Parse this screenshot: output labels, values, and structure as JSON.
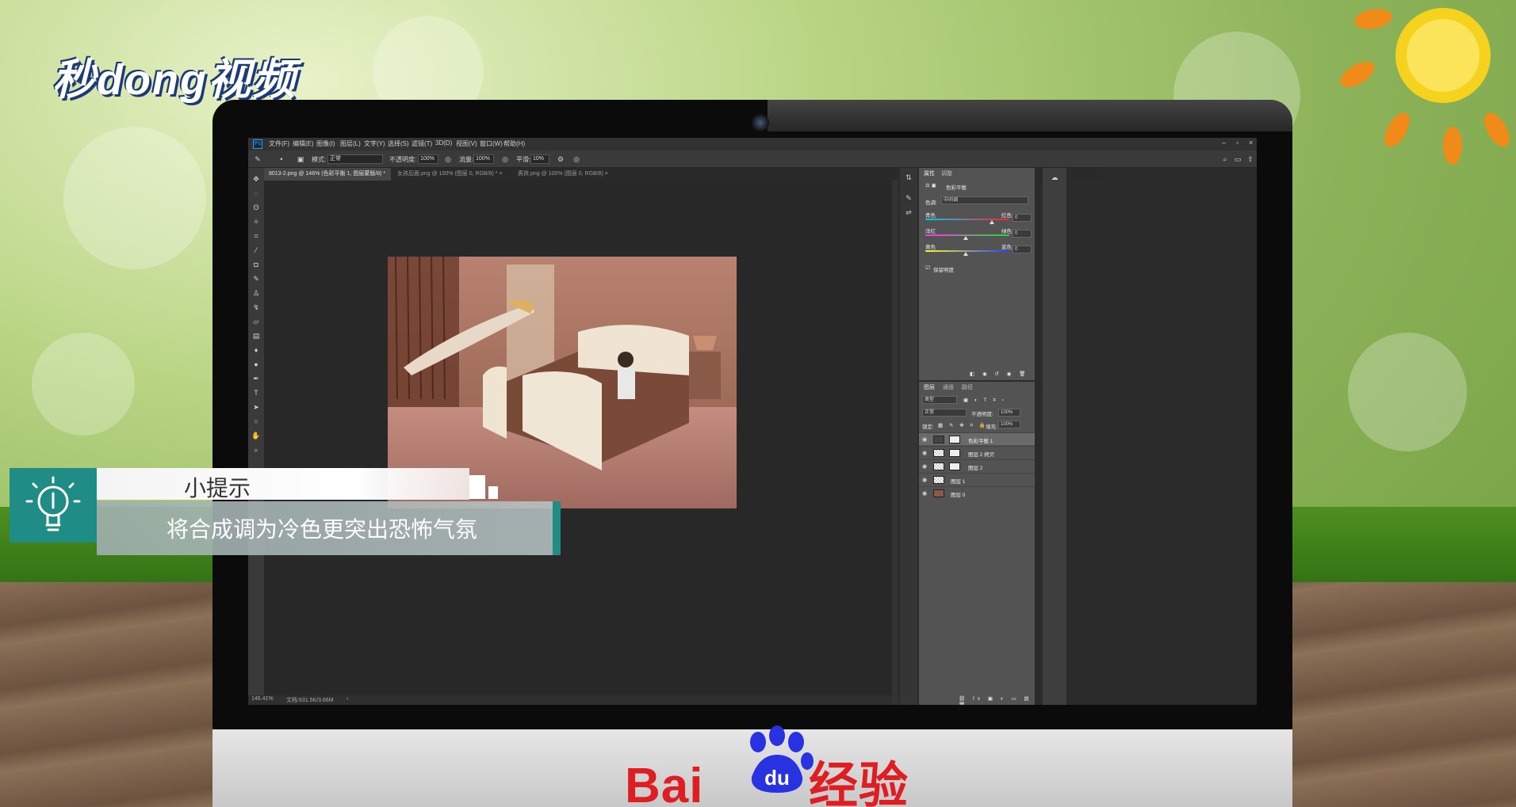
{
  "brand": {
    "logo_text": "秒dong视频",
    "baidu_text": "Bai",
    "baidu_du": "du",
    "baidu_suffix": "经验"
  },
  "photoshop": {
    "menu": [
      "文件(F)",
      "编辑(E)",
      "图像(I)",
      "图层(L)",
      "文字(Y)",
      "选择(S)",
      "滤镜(T)",
      "3D(D)",
      "视图(V)",
      "窗口(W)",
      "帮助(H)"
    ],
    "options": {
      "mode_label": "模式:",
      "mode_value": "正常",
      "opacity_label": "不透明度:",
      "opacity_value": "100%",
      "flow_label": "流量:",
      "flow_value": "100%",
      "smooth_label": "平滑:",
      "smooth_value": "10%"
    },
    "tabs": [
      "8013-2.png @ 146% (色彩平衡 1, 图层蒙版/8) * ×",
      "女孩后面.png @ 100% (图层 0, RGB/8) * ×",
      "男孩.png @ 100% (图层 0, RGB/8) ×"
    ],
    "status": {
      "zoom": "146.41%",
      "doc": "文档:631.5K/3.66M"
    },
    "properties": {
      "tab1": "属性",
      "tab2": "调整",
      "title": "色彩平衡",
      "tone_label": "色调:",
      "tone_value": "中间调",
      "cyan": "青色",
      "red": "红色",
      "val1": "0",
      "magenta": "洋红",
      "green": "绿色",
      "val2": "0",
      "yellow": "黄色",
      "blue": "蓝色",
      "val3": "0",
      "preserve": "保留明度"
    },
    "layers_panel": {
      "tab1": "图层",
      "tab2": "通道",
      "tab3": "路径",
      "kind": "类型",
      "blend": "正常",
      "opacity_label": "不透明度:",
      "opacity_value": "100%",
      "lock_label": "锁定:",
      "fill_label": "填充:",
      "fill_value": "100%",
      "layers": [
        "色彩平衡 1",
        "图层 2 拷贝",
        "图层 2",
        "图层 1",
        "图层 0"
      ]
    }
  },
  "tip": {
    "title": "小提示",
    "body": "将合成调为冷色更突出恐怖气氛"
  }
}
